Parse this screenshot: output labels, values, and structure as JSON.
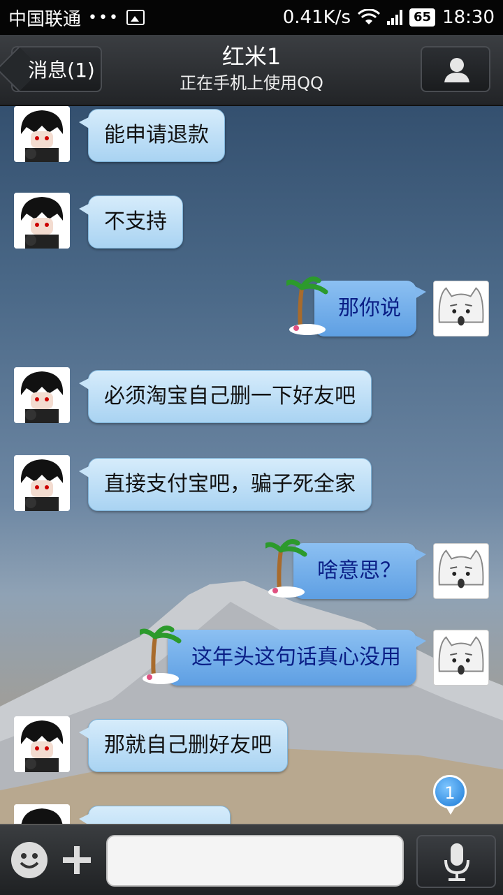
{
  "status_bar": {
    "carrier": "中国联通",
    "dots": "•••",
    "speed": "0.41K/s",
    "battery": "65",
    "time": "18:30"
  },
  "header": {
    "back_label": "消息(1)",
    "contact_name": "红米1",
    "contact_status": "正在手机上使用QQ"
  },
  "messages": [
    {
      "side": "left",
      "text": "能申请退款"
    },
    {
      "side": "left",
      "text": "不支持"
    },
    {
      "side": "right",
      "text": "那你说"
    },
    {
      "side": "left",
      "text": "必须淘宝自己删一下好友吧"
    },
    {
      "side": "left",
      "text": "直接支付宝吧，骗子死全家"
    },
    {
      "side": "right",
      "text": "啥意思？"
    },
    {
      "side": "right",
      "text": "这年头这句话真心没用"
    },
    {
      "side": "left",
      "text": "那就自己删好友吧"
    },
    {
      "side": "left",
      "text": ""
    }
  ],
  "unread_count": "1",
  "input": {
    "placeholder": ""
  },
  "colors": {
    "bubble_left": "#b8dcf5",
    "bubble_right": "#6fabe9",
    "bubble_right_text": "#0a1e86"
  }
}
